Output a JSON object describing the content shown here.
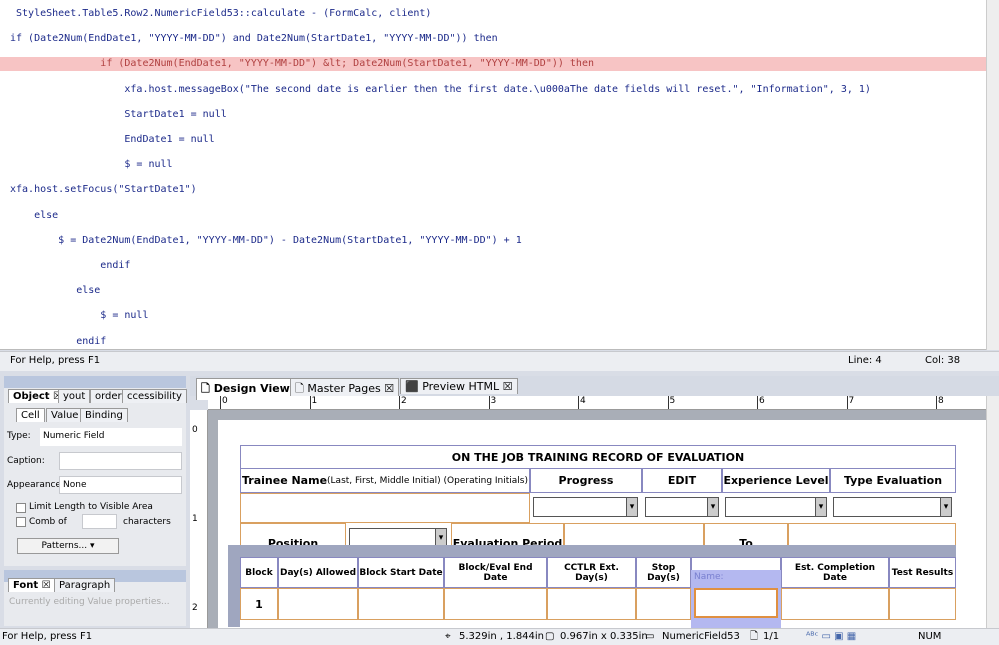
{
  "editor": {
    "lines": [
      " StyleSheet.Table5.Row2.NumericField53::calculate - (FormCalc, client)",
      "if (Date2Num(EndDate1, \"YYYY-MM-DD\") and Date2Num(StartDate1, \"YYYY-MM-DD\")) then",
      "               if (Date2Num(EndDate1, \"YYYY-MM-DD\") &lt; Date2Num(StartDate1, \"YYYY-MM-DD\")) then",
      "                   xfa.host.messageBox(\"The second date is earlier then the first date.\\u000aThe date fields will reset.\", \"Information\", 3, 1)",
      "                   StartDate1 = null",
      "                   EndDate1 = null",
      "                   $ = null",
      "xfa.host.setFocus(\"StartDate1\")",
      "    else",
      "        $ = Date2Num(EndDate1, \"YYYY-MM-DD\") - Date2Num(StartDate1, \"YYYY-MM-DD\") + 1",
      "               endif",
      "           else",
      "               $ = null",
      "           endif"
    ],
    "highlight_line": 3,
    "status": "For Help, press F1",
    "line": "Line: 4",
    "col": "Col: 38"
  },
  "object_panel": {
    "tabs": [
      "Object",
      "yout",
      "order",
      "ccessibility"
    ],
    "subtabs": [
      "Cell",
      "Value",
      "Binding"
    ],
    "type_label": "Type:",
    "type_value": "Numeric Field",
    "caption_label": "Caption:",
    "appearance_label": "Appearance:",
    "appearance_value": "None",
    "limit_length": "Limit Length to Visible Area",
    "comb_of": "Comb of",
    "characters": "characters",
    "patterns": "Patterns..."
  },
  "font_panel": {
    "tabs": [
      "Font",
      "Paragraph"
    ],
    "info": "Currently editing Value properties..."
  },
  "view_tabs": [
    "Design View",
    "Master Pages",
    "Preview HTML"
  ],
  "ruler": {
    "h": [
      "0",
      "1",
      "2",
      "3",
      "4",
      "5",
      "6",
      "7",
      "8"
    ],
    "v": [
      "0",
      "1",
      "2"
    ]
  },
  "form": {
    "title": "ON THE JOB TRAINING RECORD OF EVALUATION",
    "trainee_bold": "Trainee Name",
    "trainee_rest": " (Last, First, Middle Initial) (Operating Initials)",
    "headers": [
      "Progress",
      "EDIT",
      "Experience Level",
      "Type Evaluation"
    ],
    "position": "Position",
    "eval_period": "Evaluation Period",
    "to": "To",
    "columns": [
      "Block",
      "Day(s) Allowed",
      "Block Start Date",
      "Block/Eval End Date",
      "CCTLR Ext. Day(s)",
      "Stop Day(s)",
      "",
      "Est. Completion Date",
      "Test Results"
    ],
    "row1": "1",
    "tooltip": "Name: NumericField53"
  },
  "statusbar": {
    "help": "For Help, press F1",
    "position": "5.329in , 1.844in",
    "size": "0.967in x 0.335in",
    "object": "NumericField53",
    "page": "1/1",
    "num": "NUM"
  }
}
